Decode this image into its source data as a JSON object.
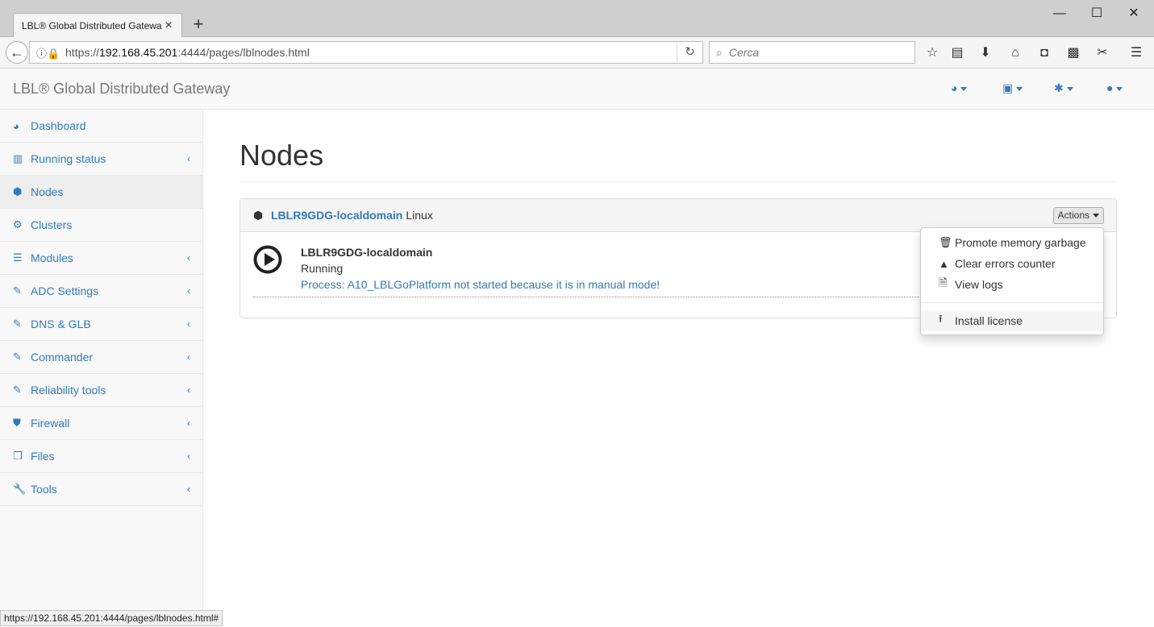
{
  "browser": {
    "tab_title": "LBL® Global Distributed Gateway",
    "url_prefix": "https://",
    "url_host": "192.168.45.201",
    "url_path": ":4444/pages/lblnodes.html",
    "search_placeholder": "Cerca",
    "status_url": "https://192.168.45.201:4444/pages/lblnodes.html#"
  },
  "navbar": {
    "brand": "LBL® Global Distributed Gateway",
    "menus": [
      "dashboard-menu",
      "save-menu",
      "settings-menu",
      "user-menu"
    ]
  },
  "sidebar": {
    "items": [
      {
        "label": "Dashboard",
        "icon": "dashboard-icon",
        "has_submenu": false
      },
      {
        "label": "Running status",
        "icon": "bar-chart-icon",
        "has_submenu": true
      },
      {
        "label": "Nodes",
        "icon": "cube-icon",
        "has_submenu": false,
        "active": true
      },
      {
        "label": "Clusters",
        "icon": "cogs-icon",
        "has_submenu": false
      },
      {
        "label": "Modules",
        "icon": "list-icon",
        "has_submenu": true
      },
      {
        "label": "ADC Settings",
        "icon": "edit-icon",
        "has_submenu": true
      },
      {
        "label": "DNS & GLB",
        "icon": "edit-icon",
        "has_submenu": true
      },
      {
        "label": "Commander",
        "icon": "edit-icon",
        "has_submenu": true
      },
      {
        "label": "Reliability tools",
        "icon": "edit-icon",
        "has_submenu": true
      },
      {
        "label": "Firewall",
        "icon": "shield-icon",
        "has_submenu": true
      },
      {
        "label": "Files",
        "icon": "files-icon",
        "has_submenu": true
      },
      {
        "label": "Tools",
        "icon": "wrench-icon",
        "has_submenu": true
      }
    ]
  },
  "main": {
    "page_title": "Nodes",
    "panel": {
      "node_link": "LBLR9GDG-localdomain",
      "os": "Linux",
      "actions_label": "Actions"
    },
    "node": {
      "name": "LBLR9GDG-localdomain",
      "status": "Running",
      "process_message": "Process: A10_LBLGoPlatform not started because it is in manual mode!"
    },
    "actions_menu": {
      "items": [
        {
          "label": "Promote memory garbage",
          "icon": "trash-icon"
        },
        {
          "label": "Clear errors counter",
          "icon": "warning-icon"
        },
        {
          "label": "View logs",
          "icon": "file-icon"
        }
      ],
      "after_divider": [
        {
          "label": "Install license",
          "icon": "upload-icon",
          "highlighted": true
        }
      ]
    }
  }
}
